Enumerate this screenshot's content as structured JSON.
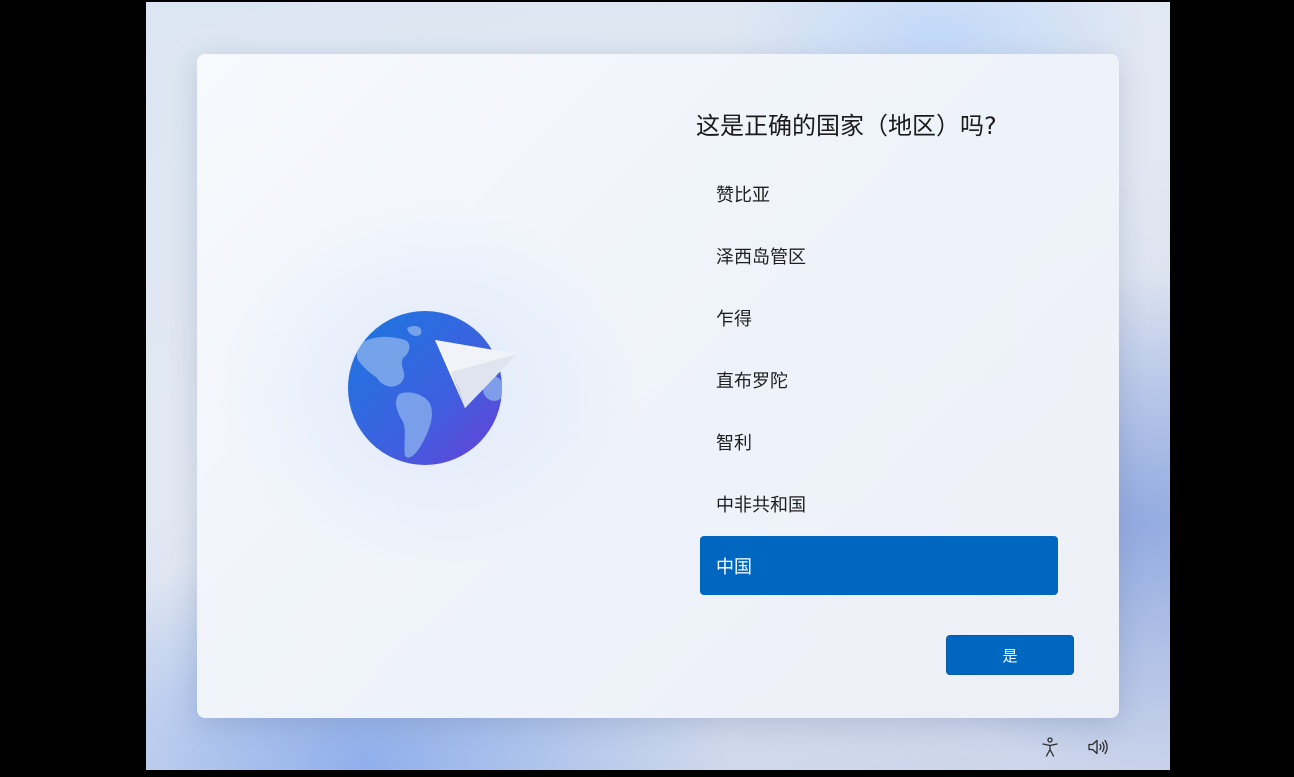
{
  "page": {
    "title": "这是正确的国家（地区）吗?"
  },
  "regions": [
    {
      "label": "赞比亚",
      "selected": false
    },
    {
      "label": "泽西岛管区",
      "selected": false
    },
    {
      "label": "乍得",
      "selected": false
    },
    {
      "label": "直布罗陀",
      "selected": false
    },
    {
      "label": "智利",
      "selected": false
    },
    {
      "label": "中非共和国",
      "selected": false
    },
    {
      "label": "中国",
      "selected": true
    }
  ],
  "actions": {
    "yes_label": "是"
  },
  "icons": {
    "illustration": "globe-with-paper-plane-icon",
    "accessibility": "accessibility-icon",
    "volume": "volume-icon"
  },
  "colors": {
    "accent": "#0067c0",
    "selected_text": "#ffffff",
    "text": "#1b1b1b"
  }
}
